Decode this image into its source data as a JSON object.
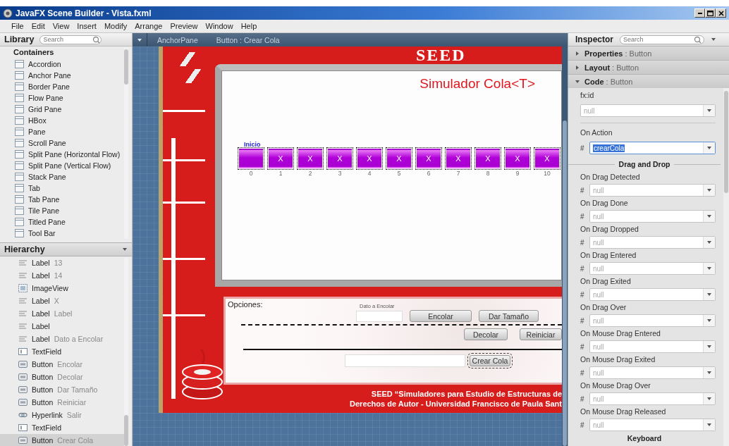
{
  "window": {
    "title": "JavaFX Scene Builder - Vista.fxml"
  },
  "menu": [
    "File",
    "Edit",
    "View",
    "Insert",
    "Modify",
    "Arrange",
    "Preview",
    "Window",
    "Help"
  ],
  "library": {
    "title": "Library",
    "placeholder": "Search",
    "section": "Containers",
    "items": [
      {
        "label": "Accordion"
      },
      {
        "label": "Anchor Pane"
      },
      {
        "label": "Border Pane"
      },
      {
        "label": "Flow Pane"
      },
      {
        "label": "Grid Pane"
      },
      {
        "label": "HBox"
      },
      {
        "label": "Pane"
      },
      {
        "label": "Scroll Pane"
      },
      {
        "label": "Split Pane (Horizontal Flow)"
      },
      {
        "label": "Split Pane (Vertical Flow)"
      },
      {
        "label": "Stack Pane"
      },
      {
        "label": "Tab"
      },
      {
        "label": "Tab Pane"
      },
      {
        "label": "Tile Pane"
      },
      {
        "label": "Titled Pane"
      },
      {
        "label": "Tool Bar"
      }
    ]
  },
  "hierarchy": {
    "title": "Hierarchy",
    "items": [
      {
        "kind": "label",
        "type": "Label",
        "name": "13",
        "selected": false
      },
      {
        "kind": "label",
        "type": "Label",
        "name": "14",
        "selected": false
      },
      {
        "kind": "image",
        "type": "ImageView",
        "selected": false
      },
      {
        "kind": "label",
        "type": "Label",
        "name": "X",
        "selected": false
      },
      {
        "kind": "label",
        "type": "Label",
        "name": "Label",
        "selected": false
      },
      {
        "kind": "label",
        "type": "Label",
        "selected": false
      },
      {
        "kind": "label",
        "type": "Label",
        "name": "Dato a Encolar",
        "selected": false
      },
      {
        "kind": "textfield",
        "type": "TextField",
        "selected": false
      },
      {
        "kind": "button",
        "type": "Button",
        "name": "Encolar",
        "selected": false
      },
      {
        "kind": "button",
        "type": "Button",
        "name": "Decolar",
        "selected": false
      },
      {
        "kind": "button",
        "type": "Button",
        "name": "Dar Tamaño",
        "selected": false
      },
      {
        "kind": "button",
        "type": "Button",
        "name": "Reiniciar",
        "selected": false
      },
      {
        "kind": "hyperlink",
        "type": "Hyperlink",
        "name": "Salir",
        "selected": false
      },
      {
        "kind": "textfield",
        "type": "TextField",
        "selected": false
      },
      {
        "kind": "button",
        "type": "Button",
        "name": "Crear Cola",
        "selected": true
      }
    ]
  },
  "breadcrumb": [
    "AnchorPane",
    "Button : Crear Cola"
  ],
  "preview": {
    "banner": "SEED",
    "title": "Simulador Cola<T>",
    "start_label": "Inicio",
    "cells": [
      {
        "index": "0"
      },
      {
        "index": "1",
        "text": "X"
      },
      {
        "index": "2",
        "text": "X"
      },
      {
        "index": "3",
        "text": "X"
      },
      {
        "index": "4",
        "text": "X"
      },
      {
        "index": "5",
        "text": "X"
      },
      {
        "index": "6",
        "text": "X"
      },
      {
        "index": "7",
        "text": "X"
      },
      {
        "index": "8",
        "text": "X"
      },
      {
        "index": "9",
        "text": "X"
      },
      {
        "index": "10",
        "text": "X"
      }
    ],
    "options": {
      "title": "Opciones:",
      "data_label": "Dato a Encolar",
      "buttons": [
        "Encolar",
        "Dar Tamaño",
        "Decolar",
        "Reiniciar"
      ],
      "create_button": {
        "label": "Crear Cola",
        "selected": true
      }
    },
    "footer": [
      "SEED “Simuladores para Estudio de Estructuras de",
      "Derechos de Autor - Universidad Francisco de Paula Sant"
    ]
  },
  "inspector": {
    "title": "Inspector",
    "placeholder": "Search",
    "sections": [
      {
        "name": "Properties",
        "type": ": Button",
        "expanded": false
      },
      {
        "name": "Layout",
        "type": ": Button",
        "expanded": false
      },
      {
        "name": "Code",
        "type": ": Button",
        "expanded": true
      }
    ],
    "fxid": {
      "label": "fx:id",
      "placeholder": "null"
    },
    "on_action": {
      "label": "On Action",
      "prefix": "#",
      "value": "crearCola"
    },
    "group": "Drag and Drop",
    "events": [
      {
        "label": "On Drag Detected",
        "prefix": "#",
        "placeholder": "null"
      },
      {
        "label": "On Drag Done",
        "prefix": "#",
        "placeholder": "null"
      },
      {
        "label": "On Drag Dropped",
        "prefix": "#",
        "placeholder": "null"
      },
      {
        "label": "On Drag Entered",
        "prefix": "#",
        "placeholder": "null"
      },
      {
        "label": "On Drag Exited",
        "prefix": "#",
        "placeholder": "null"
      },
      {
        "label": "On Drag Over",
        "prefix": "#",
        "placeholder": "null"
      },
      {
        "label": "On Mouse Drag Entered",
        "prefix": "#",
        "placeholder": "null"
      },
      {
        "label": "On Mouse Drag Exited",
        "prefix": "#",
        "placeholder": "null"
      },
      {
        "label": "On Mouse Drag Over",
        "prefix": "#",
        "placeholder": "null"
      },
      {
        "label": "On Mouse Drag Released",
        "prefix": "#",
        "placeholder": "null"
      }
    ],
    "next_group": "Keyboard"
  }
}
